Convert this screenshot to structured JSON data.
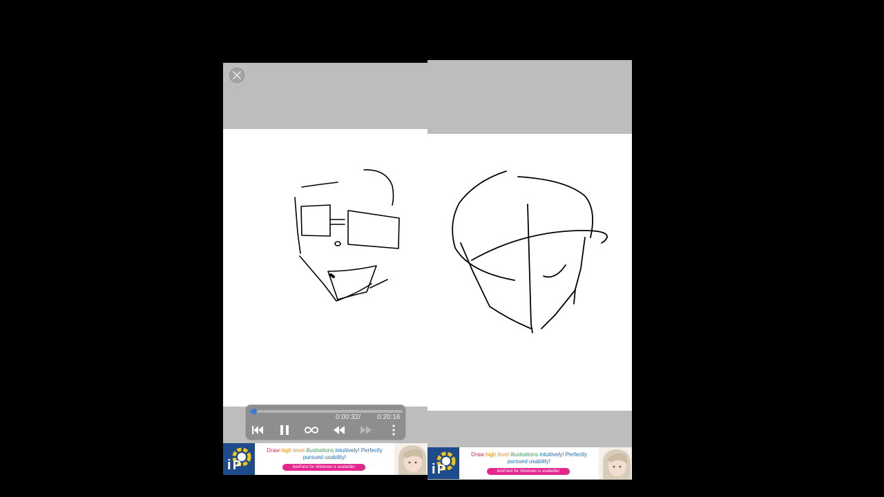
{
  "player": {
    "current_time": "0:00:32/",
    "total_time": "0:20:16",
    "progress_fraction": 0.026
  },
  "ads": [
    {
      "line1_draw": "Draw ",
      "line1_high": "high level ",
      "line1_ill": "illustrations ",
      "line1_intuit": "intuitively! ",
      "line1_rest": "Perfectly",
      "line2": "pursued usability!",
      "button": "ibisPaint for Windows is available!"
    },
    {
      "line1_draw": "Draw ",
      "line1_high": "high level ",
      "line1_ill": "illustrations ",
      "line1_intuit": "intuitively! ",
      "line1_rest": "Perfectly",
      "line2": "pursued usability!",
      "button": "ibisPaint for Windows is available!"
    }
  ],
  "colors": {
    "background": "#000000",
    "panel_gray": "#bdbdbd",
    "canvas": "#ffffff",
    "progress": "#3a78d8",
    "ad_logo": "#1d4b8c",
    "ad_button": "#e4268f"
  },
  "icons": [
    "close-icon",
    "skip-to-start-icon",
    "pause-icon",
    "loop-icon",
    "rewind-icon",
    "fast-forward-icon",
    "more-vertical-icon",
    "ibispaint-logo-icon"
  ]
}
